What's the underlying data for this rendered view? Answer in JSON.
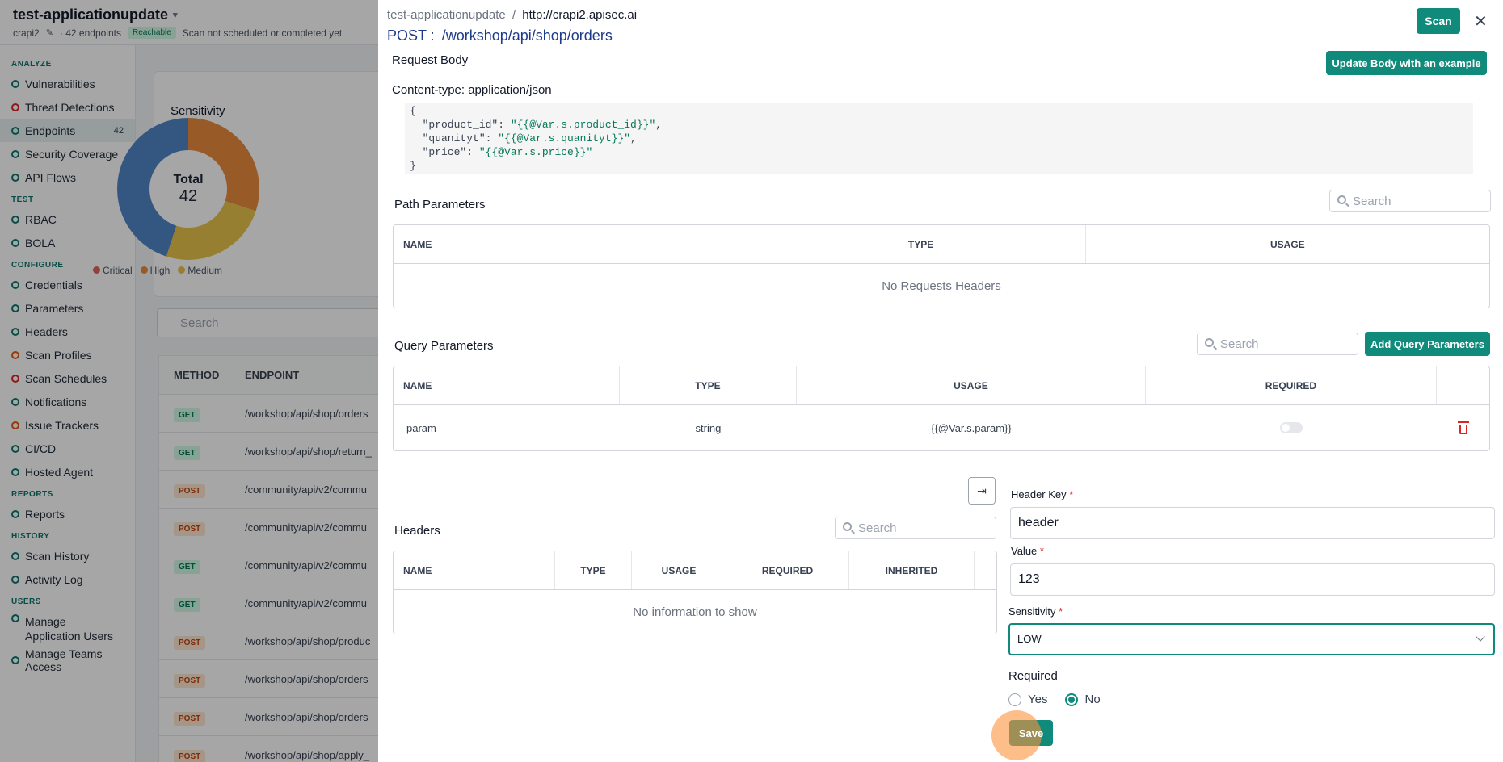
{
  "app": {
    "title": "test-applicationupdate",
    "subtitle_app": "crapi2",
    "endpoints_count": "42 endpoints",
    "reachable": "Reachable",
    "scan_status": "Scan not scheduled or completed yet"
  },
  "sidebar": {
    "sections": [
      {
        "title": "ANALYZE",
        "items": [
          {
            "label": "Vulnerabilities",
            "icon": "shield-icon"
          },
          {
            "label": "Threat Detections",
            "icon": "alert-icon"
          },
          {
            "label": "Endpoints",
            "icon": "endpoints-icon",
            "count": "42",
            "active": true
          },
          {
            "label": "Security Coverage",
            "icon": "coverage-icon"
          },
          {
            "label": "API Flows",
            "icon": "flow-icon"
          }
        ]
      },
      {
        "title": "TEST",
        "items": [
          {
            "label": "RBAC",
            "icon": "users-icon"
          },
          {
            "label": "BOLA",
            "icon": "shield-check-icon"
          }
        ]
      },
      {
        "title": "CONFIGURE",
        "items": [
          {
            "label": "Credentials",
            "icon": "key-icon"
          },
          {
            "label": "Parameters",
            "icon": "braces-icon"
          },
          {
            "label": "Headers",
            "icon": "table-icon"
          },
          {
            "label": "Scan Profiles",
            "icon": "gauge-icon"
          },
          {
            "label": "Scan Schedules",
            "icon": "calendar-icon"
          },
          {
            "label": "Notifications",
            "icon": "bell-icon"
          },
          {
            "label": "Issue Trackers",
            "icon": "tracker-icon"
          },
          {
            "label": "CI/CD",
            "icon": "cicd-icon"
          },
          {
            "label": "Hosted Agent",
            "icon": "server-icon"
          }
        ]
      },
      {
        "title": "REPORTS",
        "items": [
          {
            "label": "Reports",
            "icon": "report-icon"
          }
        ]
      },
      {
        "title": "HISTORY",
        "items": [
          {
            "label": "Scan History",
            "icon": "history-icon"
          },
          {
            "label": "Activity Log",
            "icon": "log-icon"
          }
        ]
      },
      {
        "title": "USERS",
        "items": [
          {
            "label": "Manage Application Users",
            "icon": "users-icon"
          },
          {
            "label": "Manage Teams Access",
            "icon": "team-icon"
          }
        ]
      }
    ]
  },
  "background": {
    "chart_title": "Sensitivity",
    "total_label": "Total",
    "total_value": "42",
    "legend": [
      {
        "label": "Critical",
        "color": "#e0655a"
      },
      {
        "label": "High",
        "color": "#ea8a3d"
      },
      {
        "label": "Medium",
        "color": "#e6c34a"
      }
    ],
    "search_placeholder": "Search",
    "table_headers": [
      "METHOD",
      "ENDPOINT"
    ],
    "rows": [
      {
        "method": "GET",
        "endpoint": "/workshop/api/shop/orders"
      },
      {
        "method": "GET",
        "endpoint": "/workshop/api/shop/return_"
      },
      {
        "method": "POST",
        "endpoint": "/community/api/v2/commu"
      },
      {
        "method": "POST",
        "endpoint": "/community/api/v2/commu"
      },
      {
        "method": "GET",
        "endpoint": "/community/api/v2/commu"
      },
      {
        "method": "GET",
        "endpoint": "/community/api/v2/commu"
      },
      {
        "method": "POST",
        "endpoint": "/workshop/api/shop/produc"
      },
      {
        "method": "POST",
        "endpoint": "/workshop/api/shop/orders"
      },
      {
        "method": "POST",
        "endpoint": "/workshop/api/shop/orders"
      },
      {
        "method": "POST",
        "endpoint": "/workshop/api/shop/apply_"
      }
    ]
  },
  "drawer": {
    "breadcrumb_app": "test-applicationupdate",
    "breadcrumb_sep": "/",
    "breadcrumb_url": "http://crapi2.apisec.ai",
    "method": "POST :",
    "path": "/workshop/api/shop/orders",
    "scan_label": "Scan",
    "close_icon": "close-icon",
    "request_body": {
      "title": "Request Body",
      "update_button": "Update Body with an example",
      "content_type": "Content-type: application/json",
      "code_lines": [
        {
          "pre": "{",
          "str": "",
          "post": ""
        },
        {
          "pre": "  \"product_id\": ",
          "str": "\"{{@Var.s.product_id}}\"",
          "post": ","
        },
        {
          "pre": "  \"quanityt\": ",
          "str": "\"{{@Var.s.quanityt}}\"",
          "post": ","
        },
        {
          "pre": "  \"price\": ",
          "str": "\"{{@Var.s.price}}\"",
          "post": ""
        },
        {
          "pre": "}",
          "str": "",
          "post": ""
        }
      ]
    },
    "path_params": {
      "title": "Path Parameters",
      "search_placeholder": "Search",
      "columns": [
        "NAME",
        "TYPE",
        "USAGE"
      ],
      "empty": "No Requests Headers"
    },
    "query_params": {
      "title": "Query Parameters",
      "search_placeholder": "Search",
      "add_button": "Add Query Parameters",
      "columns": [
        "NAME",
        "TYPE",
        "USAGE",
        "REQUIRED"
      ],
      "rows": [
        {
          "name": "param",
          "type": "string",
          "usage": "{{@Var.s.param}}",
          "required": false
        }
      ]
    },
    "headers": {
      "title": "Headers",
      "search_placeholder": "Search",
      "columns": [
        "NAME",
        "TYPE",
        "USAGE",
        "REQUIRED",
        "INHERITED"
      ],
      "empty": "No information to show"
    },
    "form": {
      "header_key_label": "Header Key",
      "header_key_value": "header",
      "value_label": "Value",
      "value_value": "123",
      "sensitivity_label": "Sensitivity",
      "sensitivity_value": "LOW",
      "required_label": "Required",
      "yes_label": "Yes",
      "no_label": "No",
      "required_selected": "No",
      "save_label": "Save",
      "required_mark": "*"
    }
  }
}
